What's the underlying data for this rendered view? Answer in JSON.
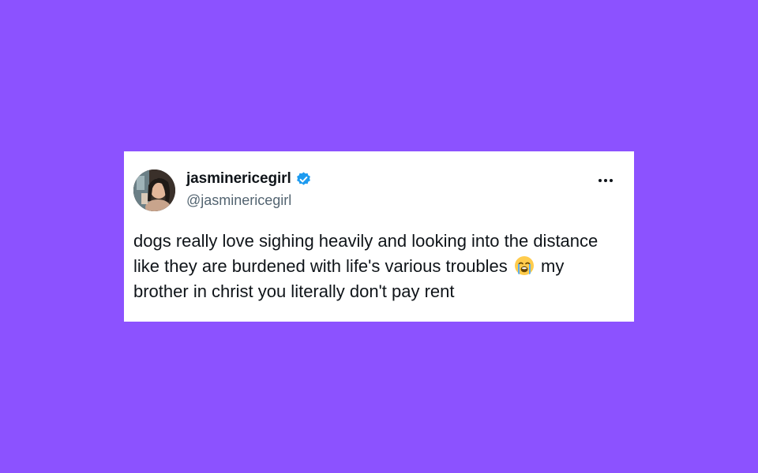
{
  "tweet": {
    "display_name": "jasminericegirl",
    "handle": "@jasminericegirl",
    "verified_icon": "verified-badge-icon",
    "more_icon": "more-options-icon",
    "avatar": "avatar-photo",
    "text_before_emoji": "dogs really love sighing heavily and looking into the distance like they are burdened with life's various troubles ",
    "emoji": "loudly-crying-face-emoji",
    "text_after_emoji": " my brother in christ you literally don't pay rent"
  },
  "colors": {
    "background": "#8c52ff",
    "card": "#ffffff",
    "text_primary": "#0f1419",
    "text_secondary": "#536471",
    "verified": "#1d9bf0"
  }
}
